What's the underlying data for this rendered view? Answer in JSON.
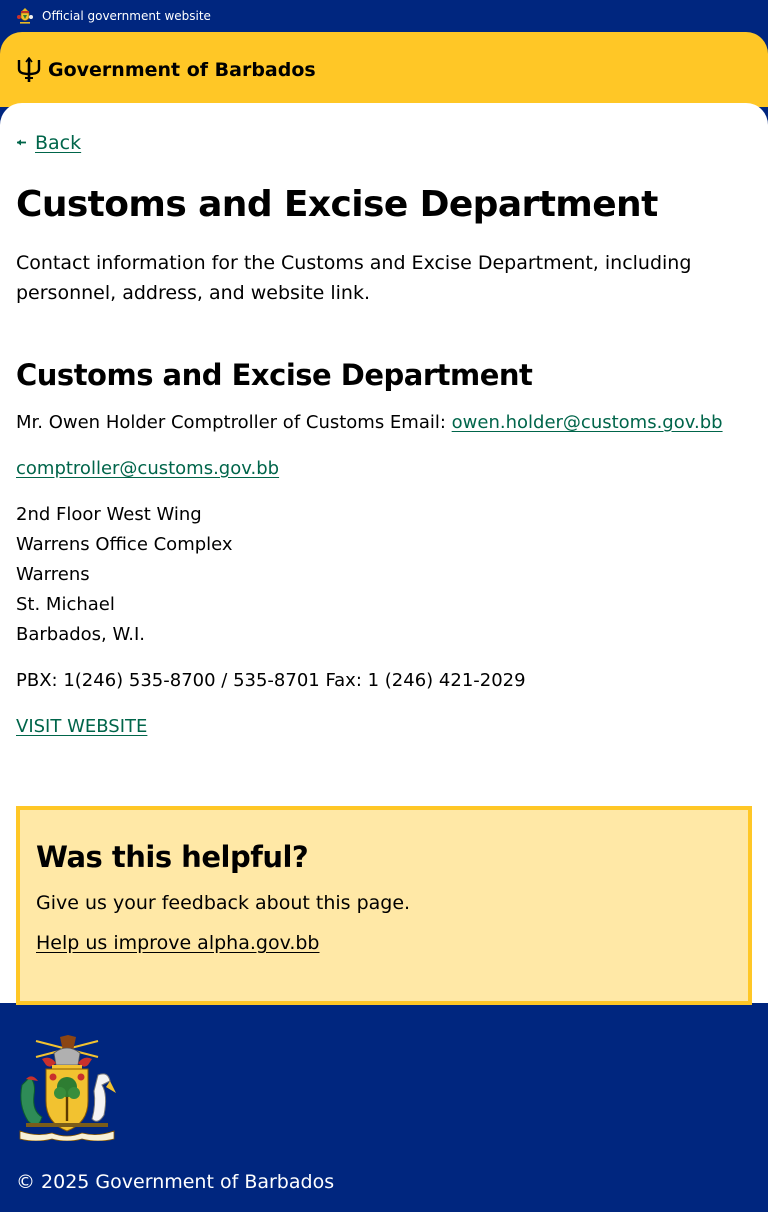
{
  "official_bar": {
    "text": "Official government website",
    "icon": "coat-of-arms-icon"
  },
  "header": {
    "logo_icon": "trident-icon",
    "title": "Government of Barbados",
    "colors": {
      "background": "#ffc726"
    }
  },
  "back": {
    "icon": "arrow-left-icon",
    "label": "Back"
  },
  "page": {
    "title": "Customs and Excise Department",
    "description": "Contact information for the Customs and Excise Department, including personnel, address, and website link."
  },
  "section": {
    "title": "Customs and Excise Department",
    "contact_text": "Mr. Owen Holder Comptroller of Customs Email: ",
    "email_primary": "owen.holder@customs.gov.bb",
    "email_secondary": "comptroller@customs.gov.bb",
    "address_lines": [
      "2nd Floor West Wing",
      "Warrens Office Complex",
      "Warrens",
      "St. Michael",
      "Barbados, W.I."
    ],
    "phones": "PBX: 1(246) 535-8700 / 535-8701 Fax: 1 (246) 421-2029",
    "website_link": "VISIT WEBSITE"
  },
  "feedback": {
    "title": "Was this helpful?",
    "text": "Give us your feedback about this page.",
    "link": "Help us improve alpha.gov.bb"
  },
  "footer": {
    "logo_icon": "coat-of-arms-icon",
    "copyright": "© 2025 Government of Barbados"
  },
  "colors": {
    "navy": "#00267f",
    "gold": "#ffc726",
    "link_green": "#00654a",
    "feedback_bg": "#ffe8a6"
  }
}
